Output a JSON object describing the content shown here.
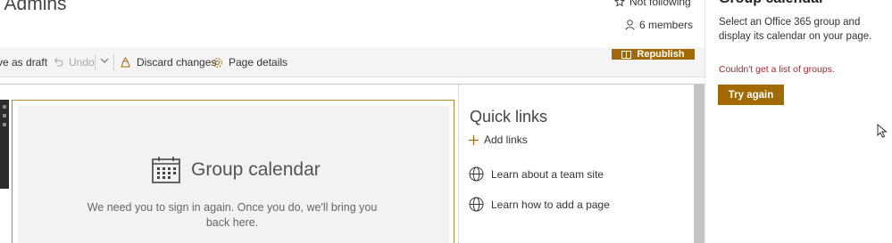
{
  "header": {
    "site_title": "t Admins",
    "following_label": "Not following",
    "members_label": "6 members"
  },
  "toolbar": {
    "save_draft_label": "ve as draft",
    "undo_label": "Undo",
    "discard_label": "Discard changes",
    "page_details_label": "Page details",
    "republish_label": "Republish"
  },
  "webpart": {
    "title": "Group calendar",
    "message": "We need you to sign in again. Once you do, we'll bring you back here."
  },
  "quick_links": {
    "title": "Quick links",
    "add_label": "Add links",
    "links": [
      {
        "label": "Learn about a team site"
      },
      {
        "label": "Learn how to add a page"
      }
    ]
  },
  "panel": {
    "title": "Group calendar",
    "description": "Select an Office 365 group and display its calendar on your page.",
    "error": "Couldn't get a list of groups.",
    "try_again_label": "Try again"
  },
  "colors": {
    "accent": "#a16a06",
    "error": "#a4262c",
    "canvas_bg": "#f3f2f1"
  }
}
